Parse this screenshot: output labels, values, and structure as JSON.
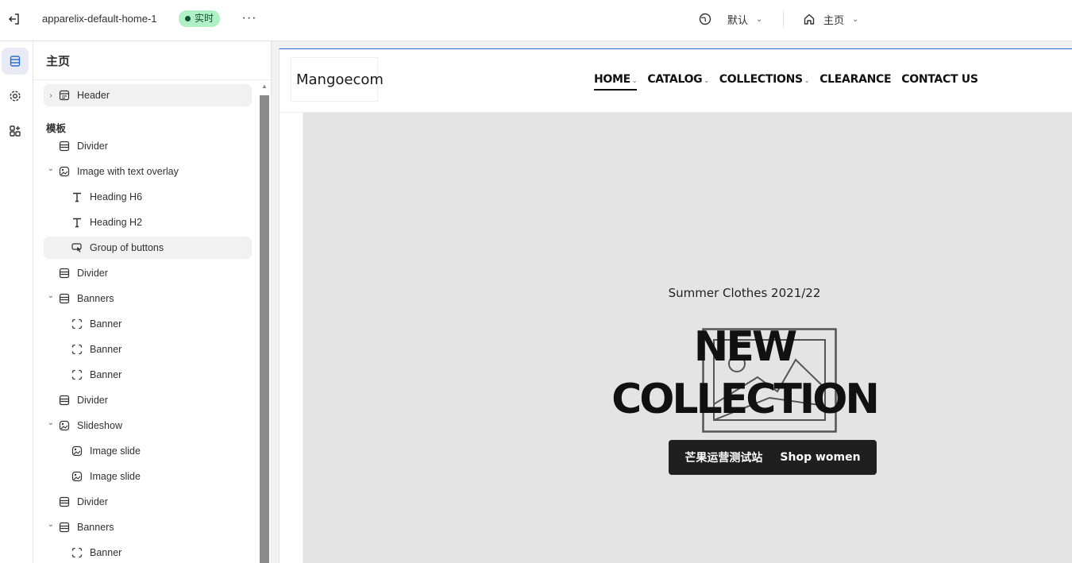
{
  "topbar": {
    "theme_name": "apparelix-default-home-1",
    "status_badge": "实时",
    "more": "···",
    "language": "默认",
    "page": "主页"
  },
  "sidebar": {
    "title": "主页",
    "header_item": "Header",
    "section_label": "模板",
    "items": [
      {
        "label": "Divider",
        "level": 0,
        "icon": "divider-icon",
        "expandable": false
      },
      {
        "label": "Image with text overlay",
        "level": 0,
        "icon": "image-text-icon",
        "expandable": true
      },
      {
        "label": "Heading H6",
        "level": 1,
        "icon": "text-icon",
        "expandable": false
      },
      {
        "label": "Heading H2",
        "level": 1,
        "icon": "text-icon",
        "expandable": false
      },
      {
        "label": "Group of buttons",
        "level": 1,
        "icon": "button-cursor-icon",
        "expandable": false,
        "selected": true
      },
      {
        "label": "Divider",
        "level": 0,
        "icon": "divider-icon",
        "expandable": false
      },
      {
        "label": "Banners",
        "level": 0,
        "icon": "divider-icon",
        "expandable": true
      },
      {
        "label": "Banner",
        "level": 1,
        "icon": "frame-icon",
        "expandable": false
      },
      {
        "label": "Banner",
        "level": 1,
        "icon": "frame-icon",
        "expandable": false
      },
      {
        "label": "Banner",
        "level": 1,
        "icon": "frame-icon",
        "expandable": false
      },
      {
        "label": "Divider",
        "level": 0,
        "icon": "divider-icon",
        "expandable": false
      },
      {
        "label": "Slideshow",
        "level": 0,
        "icon": "slideshow-icon",
        "expandable": true
      },
      {
        "label": "Image slide",
        "level": 1,
        "icon": "image-icon",
        "expandable": false
      },
      {
        "label": "Image slide",
        "level": 1,
        "icon": "image-icon",
        "expandable": false
      },
      {
        "label": "Divider",
        "level": 0,
        "icon": "divider-icon",
        "expandable": false
      },
      {
        "label": "Banners",
        "level": 0,
        "icon": "divider-icon",
        "expandable": true
      },
      {
        "label": "Banner",
        "level": 1,
        "icon": "frame-icon",
        "expandable": false
      }
    ]
  },
  "preview": {
    "logo": "Mangoecom",
    "nav": [
      {
        "label": "HOME",
        "dropdown": true,
        "active": true
      },
      {
        "label": "CATALOG",
        "dropdown": true,
        "active": false
      },
      {
        "label": "COLLECTIONS",
        "dropdown": true,
        "active": false
      },
      {
        "label": "CLEARANCE",
        "dropdown": false,
        "active": false
      },
      {
        "label": "CONTACT US",
        "dropdown": false,
        "active": false
      }
    ],
    "hero": {
      "subtitle": "Summer Clothes 2021/22",
      "title_line1": "NEW",
      "title_line2": "COLLECTION",
      "button_part1": "芒果运营测试站",
      "button_part2": "Shop women"
    }
  },
  "colors": {
    "accent": "#2c6ecb",
    "badge_bg": "#aff0c4",
    "badge_text": "#0c5132",
    "hero_bg": "#e4e4e4",
    "button_bg": "#1f1f1f"
  }
}
